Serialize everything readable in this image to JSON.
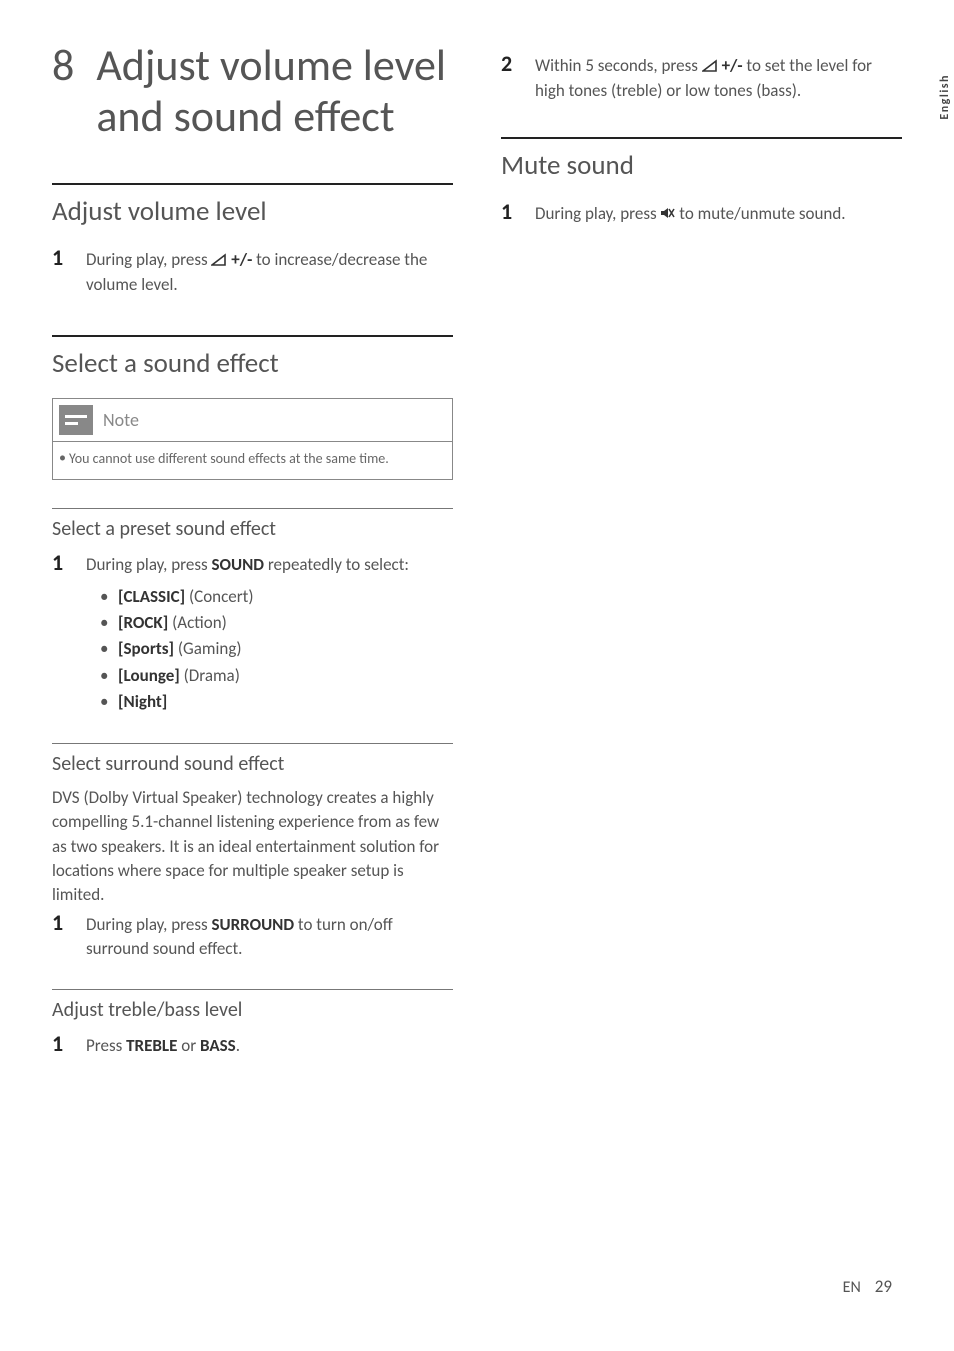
{
  "chapter": {
    "number": "8",
    "title": "Adjust volume level and sound effect"
  },
  "left": {
    "section1": {
      "heading": "Adjust volume level",
      "step1": {
        "num": "1",
        "pre": "During play, press ",
        "btn": " +/-",
        "post": " to increase/decrease the volume level."
      }
    },
    "section2": {
      "heading": "Select a sound effect",
      "note": {
        "label": "Note",
        "body": "You cannot use different sound effects at the same time."
      },
      "sub1": {
        "heading": "Select a preset sound effect",
        "step1": {
          "num": "1",
          "pre": "During play, press ",
          "btn": "SOUND",
          "post": " repeatedly to select:"
        },
        "items": [
          {
            "key": "[CLASSIC]",
            "desc": " (Concert)"
          },
          {
            "key": "[ROCK]",
            "desc": " (Action)"
          },
          {
            "key": "[Sports]",
            "desc": " (Gaming)"
          },
          {
            "key": "[Lounge]",
            "desc": " (Drama)"
          },
          {
            "key": "[Night]",
            "desc": ""
          }
        ]
      },
      "sub2": {
        "heading": "Select surround sound effect",
        "para": "DVS (Dolby Virtual Speaker) technology creates a highly compelling 5.1-channel listening experience from as few as two speakers. It is an ideal entertainment solution for locations where space for multiple speaker setup is limited.",
        "step1": {
          "num": "1",
          "pre": "During play, press ",
          "btn": "SURROUND",
          "post": " to turn on/off surround sound effect."
        }
      },
      "sub3": {
        "heading": "Adjust treble/bass level",
        "step1": {
          "num": "1",
          "pre": "Press ",
          "btn1": "TREBLE",
          "mid": " or ",
          "btn2": "BASS",
          "post": "."
        }
      }
    }
  },
  "right": {
    "step2": {
      "num": "2",
      "pre": "Within 5 seconds, press ",
      "btn": " +/-",
      "post": " to set the level for high tones (treble) or low tones (bass)."
    },
    "section3": {
      "heading": "Mute sound",
      "step1": {
        "num": "1",
        "pre": "During play, press ",
        "post": " to mute/unmute sound."
      }
    }
  },
  "sidetab": "English",
  "footer": {
    "lang": "EN",
    "page": "29"
  }
}
